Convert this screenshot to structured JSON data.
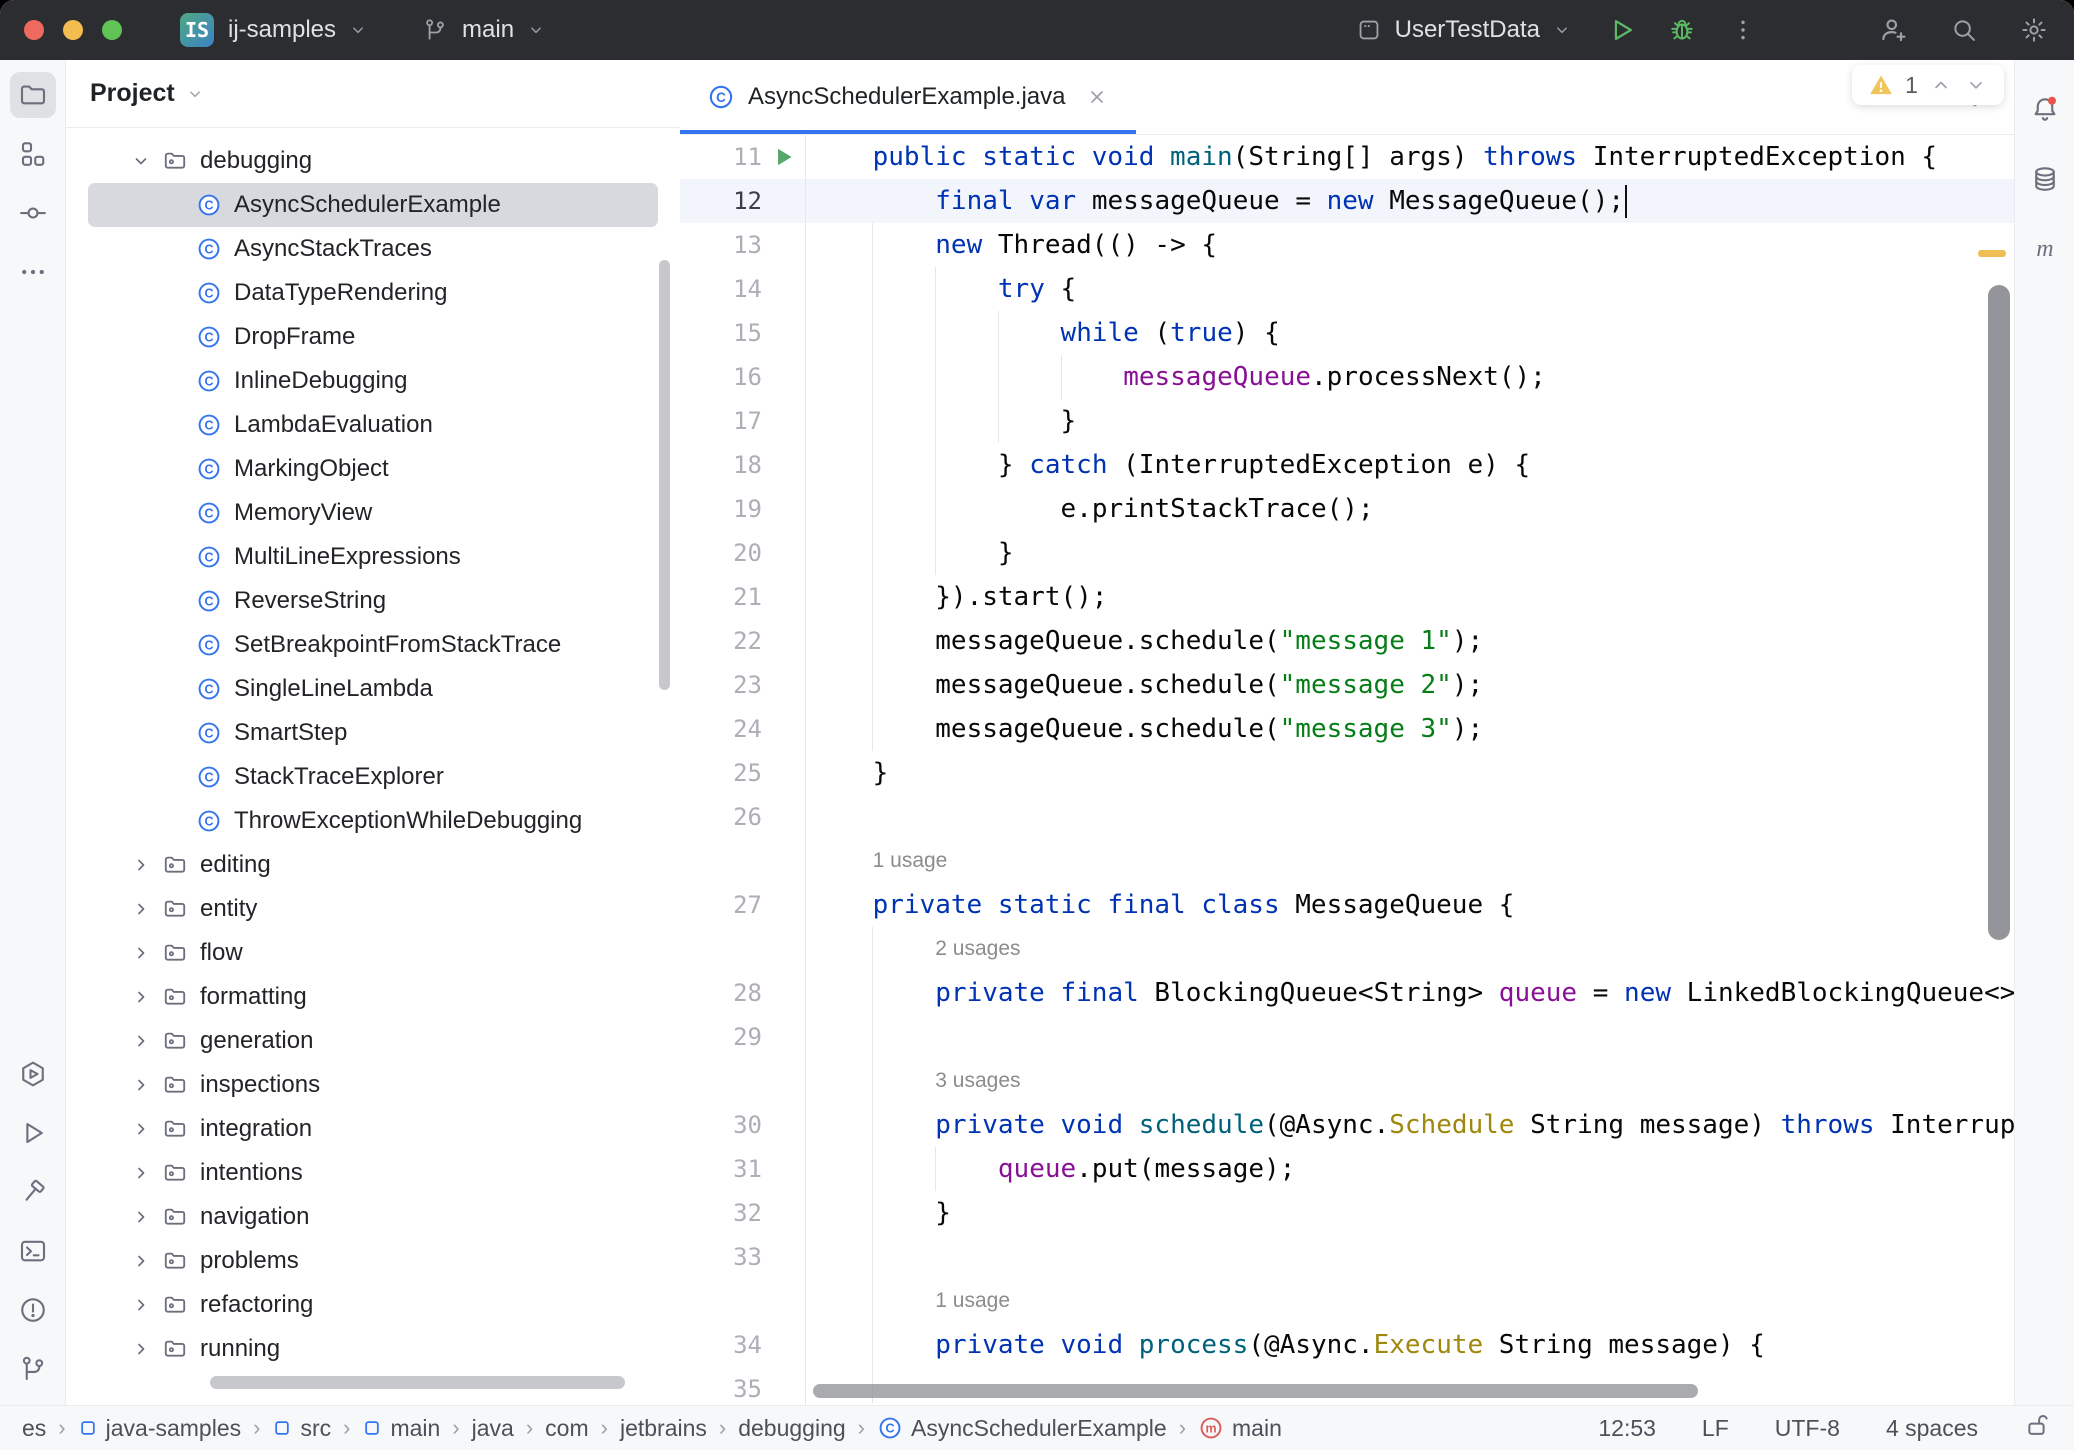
{
  "titlebar": {
    "project_badge": "IS",
    "project": "ij-samples",
    "branch": "main",
    "run_config": "UserTestData"
  },
  "toolstripes": {
    "left_top": [
      {
        "name": "project",
        "icon": "folder-tool",
        "selected": true
      },
      {
        "name": "structure",
        "icon": "structure",
        "selected": false
      },
      {
        "name": "commit",
        "icon": "commit",
        "selected": false
      },
      {
        "name": "more-tools",
        "icon": "more-h",
        "selected": false
      }
    ],
    "left_bottom": [
      {
        "name": "services",
        "icon": "services",
        "selected": false
      },
      {
        "name": "run",
        "icon": "run-outline",
        "selected": false
      },
      {
        "name": "build",
        "icon": "hammer",
        "selected": false
      },
      {
        "name": "terminal",
        "icon": "terminal",
        "selected": false
      },
      {
        "name": "problems",
        "icon": "problems",
        "selected": false
      },
      {
        "name": "git",
        "icon": "git-branch",
        "selected": false
      }
    ],
    "right": [
      {
        "name": "notifications",
        "icon": "bell-dot",
        "selected": false
      },
      {
        "name": "database",
        "icon": "database",
        "selected": false
      },
      {
        "name": "maven",
        "icon": "maven-m",
        "selected": false
      }
    ]
  },
  "project": {
    "header": "Project",
    "items": [
      {
        "kind": "folder",
        "chevron": "down",
        "label": "debugging",
        "level": 1,
        "selected": false
      },
      {
        "kind": "class",
        "label": "AsyncSchedulerExample",
        "level": 2,
        "selected": true
      },
      {
        "kind": "class",
        "label": "AsyncStackTraces",
        "level": 2,
        "selected": false
      },
      {
        "kind": "class",
        "label": "DataTypeRendering",
        "level": 2,
        "selected": false
      },
      {
        "kind": "class",
        "label": "DropFrame",
        "level": 2,
        "selected": false
      },
      {
        "kind": "class",
        "label": "InlineDebugging",
        "level": 2,
        "selected": false
      },
      {
        "kind": "class",
        "label": "LambdaEvaluation",
        "level": 2,
        "selected": false
      },
      {
        "kind": "class",
        "label": "MarkingObject",
        "level": 2,
        "selected": false
      },
      {
        "kind": "class",
        "label": "MemoryView",
        "level": 2,
        "selected": false
      },
      {
        "kind": "class",
        "label": "MultiLineExpressions",
        "level": 2,
        "selected": false
      },
      {
        "kind": "class",
        "label": "ReverseString",
        "level": 2,
        "selected": false
      },
      {
        "kind": "class",
        "label": "SetBreakpointFromStackTrace",
        "level": 2,
        "selected": false
      },
      {
        "kind": "class",
        "label": "SingleLineLambda",
        "level": 2,
        "selected": false
      },
      {
        "kind": "class",
        "label": "SmartStep",
        "level": 2,
        "selected": false
      },
      {
        "kind": "class",
        "label": "StackTraceExplorer",
        "level": 2,
        "selected": false
      },
      {
        "kind": "class",
        "label": "ThrowExceptionWhileDebugging",
        "level": 2,
        "selected": false
      },
      {
        "kind": "folder",
        "chevron": "right",
        "label": "editing",
        "level": 1,
        "selected": false
      },
      {
        "kind": "folder",
        "chevron": "right",
        "label": "entity",
        "level": 1,
        "selected": false
      },
      {
        "kind": "folder",
        "chevron": "right",
        "label": "flow",
        "level": 1,
        "selected": false
      },
      {
        "kind": "folder",
        "chevron": "right",
        "label": "formatting",
        "level": 1,
        "selected": false
      },
      {
        "kind": "folder",
        "chevron": "right",
        "label": "generation",
        "level": 1,
        "selected": false
      },
      {
        "kind": "folder",
        "chevron": "right",
        "label": "inspections",
        "level": 1,
        "selected": false
      },
      {
        "kind": "folder",
        "chevron": "right",
        "label": "integration",
        "level": 1,
        "selected": false
      },
      {
        "kind": "folder",
        "chevron": "right",
        "label": "intentions",
        "level": 1,
        "selected": false
      },
      {
        "kind": "folder",
        "chevron": "right",
        "label": "navigation",
        "level": 1,
        "selected": false
      },
      {
        "kind": "folder",
        "chevron": "right",
        "label": "problems",
        "level": 1,
        "selected": false
      },
      {
        "kind": "folder",
        "chevron": "right",
        "label": "refactoring",
        "level": 1,
        "selected": false
      },
      {
        "kind": "folder",
        "chevron": "right",
        "label": "running",
        "level": 1,
        "selected": false
      }
    ]
  },
  "editor": {
    "tab_label": "AsyncSchedulerExample.java",
    "warning_count": "1",
    "lines": [
      {
        "n": "11",
        "run": true,
        "ind": 4,
        "seg": [
          [
            "k",
            "public static void "
          ],
          [
            "m",
            "main"
          ],
          [
            "d",
            "(String[] args) "
          ],
          [
            "k",
            "throws"
          ],
          [
            "d",
            " InterruptedException {"
          ]
        ]
      },
      {
        "n": "12",
        "cur": true,
        "caret": true,
        "ind": 8,
        "seg": [
          [
            "k",
            "final"
          ],
          [
            "d",
            " "
          ],
          [
            "k",
            "var"
          ],
          [
            "d",
            " messageQueue = "
          ],
          [
            "k",
            "new"
          ],
          [
            "d",
            " MessageQueue();"
          ]
        ]
      },
      {
        "n": "13",
        "ind": 8,
        "seg": [
          [
            "k",
            "new"
          ],
          [
            "d",
            " Thread(() -> {"
          ]
        ]
      },
      {
        "n": "14",
        "ind": 12,
        "seg": [
          [
            "k",
            "try"
          ],
          [
            "d",
            " {"
          ]
        ]
      },
      {
        "n": "15",
        "ind": 16,
        "seg": [
          [
            "k",
            "while"
          ],
          [
            "d",
            " ("
          ],
          [
            "k",
            "true"
          ],
          [
            "d",
            ") {"
          ]
        ]
      },
      {
        "n": "16",
        "ind": 20,
        "seg": [
          [
            "f",
            "messageQueue"
          ],
          [
            "d",
            ".processNext();"
          ]
        ]
      },
      {
        "n": "17",
        "ind": 16,
        "seg": [
          [
            "d",
            "}"
          ]
        ]
      },
      {
        "n": "18",
        "ind": 12,
        "seg": [
          [
            "d",
            "} "
          ],
          [
            "k",
            "catch"
          ],
          [
            "d",
            " (InterruptedException e) {"
          ]
        ]
      },
      {
        "n": "19",
        "ind": 16,
        "seg": [
          [
            "d",
            "e.printStackTrace();"
          ]
        ]
      },
      {
        "n": "20",
        "ind": 12,
        "seg": [
          [
            "d",
            "}"
          ]
        ]
      },
      {
        "n": "21",
        "ind": 8,
        "seg": [
          [
            "d",
            "}).start();"
          ]
        ]
      },
      {
        "n": "22",
        "ind": 8,
        "seg": [
          [
            "d",
            "messageQueue.schedule("
          ],
          [
            "s",
            "\"message 1\""
          ],
          [
            "d",
            ");"
          ]
        ]
      },
      {
        "n": "23",
        "ind": 8,
        "seg": [
          [
            "d",
            "messageQueue.schedule("
          ],
          [
            "s",
            "\"message 2\""
          ],
          [
            "d",
            ");"
          ]
        ]
      },
      {
        "n": "24",
        "ind": 8,
        "seg": [
          [
            "d",
            "messageQueue.schedule("
          ],
          [
            "s",
            "\"message 3\""
          ],
          [
            "d",
            ");"
          ]
        ]
      },
      {
        "n": "25",
        "ind": 4,
        "seg": [
          [
            "d",
            "}"
          ]
        ]
      },
      {
        "n": "26",
        "ind": 0,
        "seg": []
      },
      {
        "inlay": "1 usage",
        "ind": 4
      },
      {
        "n": "27",
        "ind": 4,
        "seg": [
          [
            "k",
            "private static final class"
          ],
          [
            "d",
            " MessageQueue {"
          ]
        ]
      },
      {
        "inlay": "2 usages",
        "ind": 8
      },
      {
        "n": "28",
        "ind": 8,
        "seg": [
          [
            "k",
            "private final"
          ],
          [
            "d",
            " BlockingQueue<String> "
          ],
          [
            "f",
            "queue"
          ],
          [
            "d",
            " = "
          ],
          [
            "k",
            "new"
          ],
          [
            "d",
            " LinkedBlockingQueue<>();"
          ]
        ]
      },
      {
        "n": "29",
        "ind": 0,
        "seg": []
      },
      {
        "inlay": "3 usages",
        "ind": 8
      },
      {
        "n": "30",
        "ind": 8,
        "seg": [
          [
            "k",
            "private void"
          ],
          [
            "d",
            " "
          ],
          [
            "m",
            "schedule"
          ],
          [
            "d",
            "(@Async."
          ],
          [
            "a",
            "Schedule"
          ],
          [
            "d",
            " String message) "
          ],
          [
            "k",
            "throws"
          ],
          [
            "d",
            " InterruptedException {"
          ]
        ]
      },
      {
        "n": "31",
        "ind": 12,
        "seg": [
          [
            "f",
            "queue"
          ],
          [
            "d",
            ".put(message);"
          ]
        ]
      },
      {
        "n": "32",
        "ind": 8,
        "seg": [
          [
            "d",
            "}"
          ]
        ]
      },
      {
        "n": "33",
        "ind": 0,
        "seg": []
      },
      {
        "inlay": "1 usage",
        "ind": 8
      },
      {
        "n": "34",
        "ind": 8,
        "seg": [
          [
            "k",
            "private void"
          ],
          [
            "d",
            " "
          ],
          [
            "m",
            "process"
          ],
          [
            "d",
            "(@Async."
          ],
          [
            "a",
            "Execute"
          ],
          [
            "d",
            " String message) {"
          ]
        ]
      },
      {
        "n": "35",
        "ind": 0,
        "seg": []
      }
    ]
  },
  "status": {
    "breadcrumbs": [
      {
        "label": "es"
      },
      {
        "label": "java-samples",
        "icon": "module-sq"
      },
      {
        "label": "src",
        "icon": "module-sq"
      },
      {
        "label": "main",
        "icon": "module-sq"
      },
      {
        "label": "java"
      },
      {
        "label": "com"
      },
      {
        "label": "jetbrains"
      },
      {
        "label": "debugging"
      },
      {
        "label": "AsyncSchedulerExample",
        "icon": "class-c"
      },
      {
        "label": "main",
        "icon": "main-m"
      }
    ],
    "right": [
      {
        "name": "clock-position",
        "label": "12:53"
      },
      {
        "name": "line-separator",
        "label": "LF"
      },
      {
        "name": "encoding",
        "label": "UTF-8"
      },
      {
        "name": "indent-style",
        "label": "4 spaces"
      },
      {
        "name": "readonly-toggle",
        "icon": "lock-open"
      }
    ]
  },
  "colors": {
    "accent": "#3574F0",
    "keyword": "#0033B3",
    "string": "#067D17",
    "field": "#871094",
    "method": "#00627A",
    "annotation": "#9E880D",
    "warning": "#EFBE56",
    "run_green": "#55A76A",
    "titlebar_bg": "#2B2D30",
    "error_red": "#DB5C5C"
  }
}
